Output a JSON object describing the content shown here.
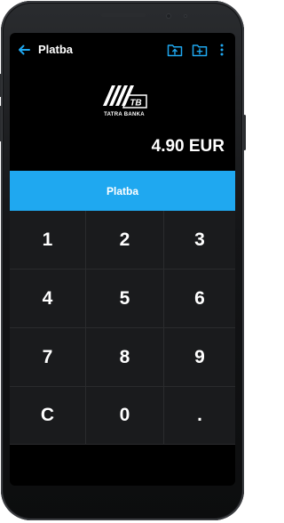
{
  "appbar": {
    "title": "Platba",
    "back_icon": "arrow-left-icon",
    "actions": [
      "folder-upload-icon",
      "folder-add-icon",
      "more-vert-icon"
    ]
  },
  "logo": {
    "initials": "TB",
    "text": "TATRA BANKA"
  },
  "payment": {
    "amount": "4.90 EUR",
    "button_label": "Platba"
  },
  "keypad": {
    "keys": [
      "1",
      "2",
      "3",
      "4",
      "5",
      "6",
      "7",
      "8",
      "9",
      "C",
      "0",
      "."
    ]
  },
  "colors": {
    "accent": "#1fa8f0",
    "background": "#000000",
    "key_background": "#1a1b1d",
    "text": "#ffffff"
  }
}
